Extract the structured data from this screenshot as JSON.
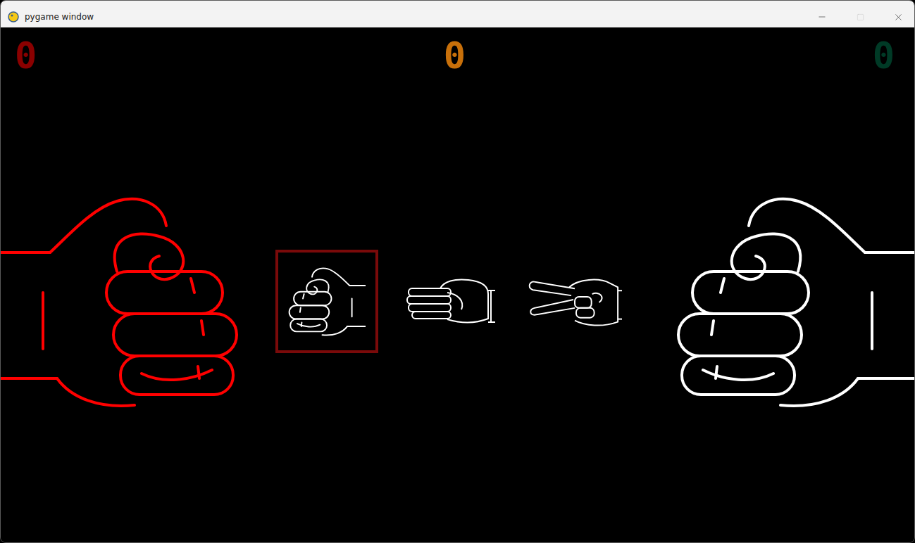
{
  "window": {
    "title": "pygame window",
    "maximize_disabled": true
  },
  "scores": [
    {
      "label": "0",
      "color": "#8a0000"
    },
    {
      "label": "0",
      "color": "#c8700a"
    },
    {
      "label": "0",
      "color": "#003a26"
    }
  ],
  "hands": [
    {
      "kind": "rock",
      "color": "#ff0000"
    },
    {
      "kind": "rock",
      "color": "#ffffff"
    }
  ],
  "choices": [
    {
      "kind": "rock",
      "selected": true
    },
    {
      "kind": "paper",
      "selected": false
    },
    {
      "kind": "scissors",
      "selected": false
    }
  ]
}
